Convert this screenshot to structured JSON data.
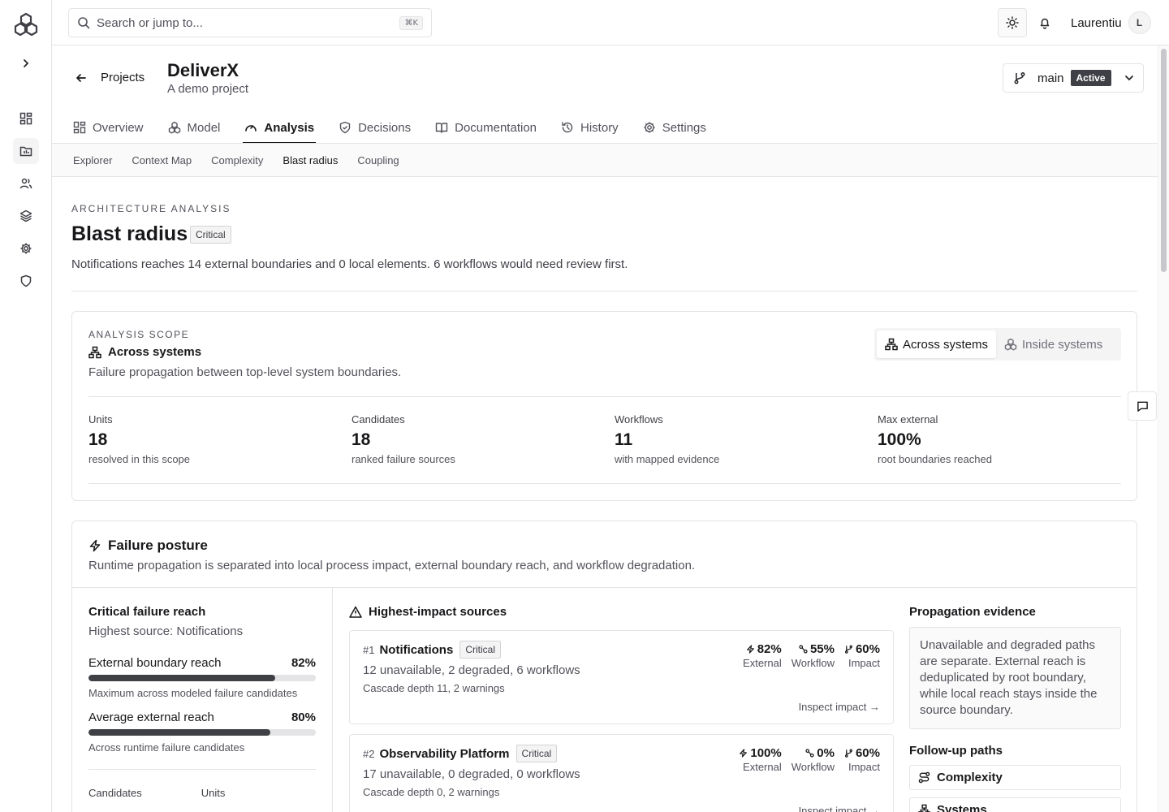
{
  "topbar": {
    "search_placeholder": "Search or jump to...",
    "shortcut": "⌘K",
    "user_name": "Laurentiu",
    "avatar_initial": "L"
  },
  "project": {
    "back_label": "Projects",
    "title": "DeliverX",
    "subtitle": "A demo project",
    "branch": "main",
    "branch_status": "Active"
  },
  "tabs": [
    {
      "label": "Overview",
      "icon": "overview-icon"
    },
    {
      "label": "Model",
      "icon": "model-icon"
    },
    {
      "label": "Analysis",
      "icon": "gauge-icon",
      "active": true
    },
    {
      "label": "Decisions",
      "icon": "shield-check-icon"
    },
    {
      "label": "Documentation",
      "icon": "book-icon"
    },
    {
      "label": "History",
      "icon": "history-icon"
    },
    {
      "label": "Settings",
      "icon": "gear-icon"
    }
  ],
  "subtabs": [
    "Explorer",
    "Context Map",
    "Complexity",
    "Blast radius",
    "Coupling"
  ],
  "page": {
    "eyebrow": "ARCHITECTURE ANALYSIS",
    "title": "Blast radius",
    "badge": "Critical",
    "description": "Notifications reaches 14 external boundaries and 0 local elements. 6 workflows would need review first."
  },
  "scope": {
    "eyebrow": "ANALYSIS SCOPE",
    "title": "Across systems",
    "description": "Failure propagation between top-level system boundaries.",
    "toggle": [
      "Across systems",
      "Inside systems"
    ],
    "stats": [
      {
        "label": "Units",
        "value": "18",
        "sub": "resolved in this scope"
      },
      {
        "label": "Candidates",
        "value": "18",
        "sub": "ranked failure sources"
      },
      {
        "label": "Workflows",
        "value": "11",
        "sub": "with mapped evidence"
      },
      {
        "label": "Max external",
        "value": "100%",
        "sub": "root boundaries reached"
      }
    ]
  },
  "posture": {
    "title": "Failure posture",
    "description": "Runtime propagation is separated into local process impact, external boundary reach, and workflow degradation.",
    "left": {
      "title": "Critical failure reach",
      "subtitle": "Highest source: Notifications",
      "metrics": [
        {
          "label": "External boundary reach",
          "value": "82%",
          "fraction": 0.82,
          "note": "Maximum across modeled failure candidates"
        },
        {
          "label": "Average external reach",
          "value": "80%",
          "fraction": 0.8,
          "note": "Across runtime failure candidates"
        }
      ],
      "footer": [
        "Candidates",
        "Units"
      ]
    },
    "sources_title": "Highest-impact sources",
    "sources": [
      {
        "rank": "#1",
        "name": "Notifications",
        "badge": "Critical",
        "line1": "12 unavailable, 2 degraded, 6 workflows",
        "line2": "Cascade depth 11, 2 warnings",
        "external": "82%",
        "workflow": "55%",
        "impact": "60%",
        "inspect": "Inspect impact →"
      },
      {
        "rank": "#2",
        "name": "Observability Platform",
        "badge": "Critical",
        "line1": "17 unavailable, 0 degraded, 0 workflows",
        "line2": "Cascade depth 0, 2 warnings",
        "external": "100%",
        "workflow": "0%",
        "impact": "60%",
        "inspect": "Inspect impact →"
      }
    ],
    "metric_labels": {
      "external": "External",
      "workflow": "Workflow",
      "impact": "Impact"
    },
    "evidence_title": "Propagation evidence",
    "evidence_text": "Unavailable and degraded paths are separate. External reach is deduplicated by root boundary, while local reach stays inside the source boundary.",
    "followup_title": "Follow-up paths",
    "followups": [
      "Complexity",
      "Systems"
    ]
  }
}
